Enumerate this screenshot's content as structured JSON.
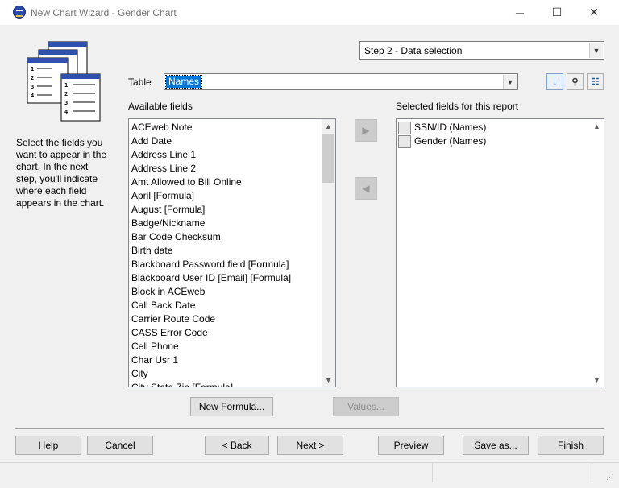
{
  "window": {
    "title": "New Chart Wizard - Gender Chart",
    "controls": {
      "minimize": "─",
      "maximize": "☐",
      "close": "✕"
    }
  },
  "step": {
    "selected": "Step 2 - Data selection"
  },
  "table": {
    "label": "Table",
    "value": "Names"
  },
  "instructions": "Select the fields you want to appear in the chart. In the next step, you'll indicate where each field appears in the chart.",
  "available": {
    "label": "Available fields",
    "items": [
      "ACEweb Note",
      "Add Date",
      "Address Line 1",
      "Address Line 2",
      "Amt Allowed to Bill Online",
      "April [Formula]",
      "August [Formula]",
      "Badge/Nickname",
      "Bar Code Checksum",
      "Birth date",
      "Blackboard Password field [Formula]",
      "Blackboard User ID [Email] [Formula]",
      "Block in ACEweb",
      "Call Back Date",
      "Carrier Route Code",
      "CASS Error Code",
      "Cell Phone",
      "Char Usr 1",
      "City",
      "City State Zip [Formula]"
    ]
  },
  "selected": {
    "label": "Selected fields for this report",
    "items": [
      "SSN/ID (Names)",
      "Gender (Names)"
    ]
  },
  "buttons": {
    "new_formula": "New Formula...",
    "values": "Values...",
    "help": "Help",
    "cancel": "Cancel",
    "back": "< Back",
    "next": "Next >",
    "preview": "Preview",
    "save_as": "Save as...",
    "finish": "Finish"
  }
}
